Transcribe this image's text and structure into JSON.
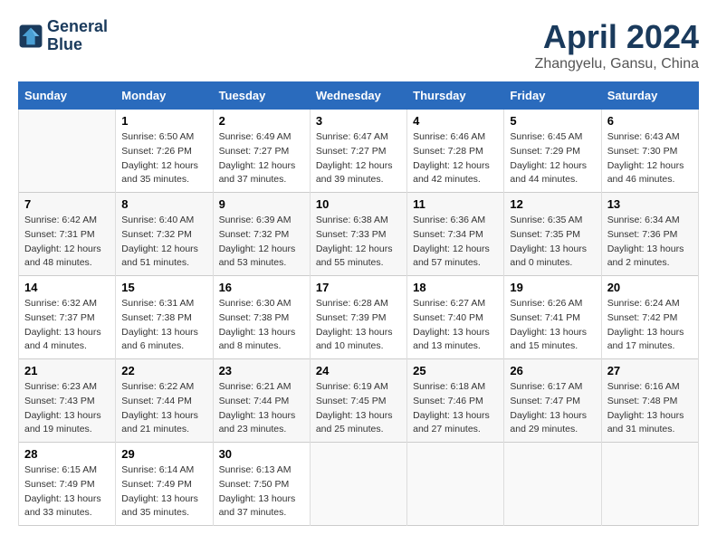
{
  "header": {
    "logo_line1": "General",
    "logo_line2": "Blue",
    "main_title": "April 2024",
    "sub_title": "Zhangyelu, Gansu, China"
  },
  "weekdays": [
    "Sunday",
    "Monday",
    "Tuesday",
    "Wednesday",
    "Thursday",
    "Friday",
    "Saturday"
  ],
  "weeks": [
    [
      {
        "day": "",
        "sunrise": "",
        "sunset": "",
        "daylight": ""
      },
      {
        "day": "1",
        "sunrise": "Sunrise: 6:50 AM",
        "sunset": "Sunset: 7:26 PM",
        "daylight": "Daylight: 12 hours and 35 minutes."
      },
      {
        "day": "2",
        "sunrise": "Sunrise: 6:49 AM",
        "sunset": "Sunset: 7:27 PM",
        "daylight": "Daylight: 12 hours and 37 minutes."
      },
      {
        "day": "3",
        "sunrise": "Sunrise: 6:47 AM",
        "sunset": "Sunset: 7:27 PM",
        "daylight": "Daylight: 12 hours and 39 minutes."
      },
      {
        "day": "4",
        "sunrise": "Sunrise: 6:46 AM",
        "sunset": "Sunset: 7:28 PM",
        "daylight": "Daylight: 12 hours and 42 minutes."
      },
      {
        "day": "5",
        "sunrise": "Sunrise: 6:45 AM",
        "sunset": "Sunset: 7:29 PM",
        "daylight": "Daylight: 12 hours and 44 minutes."
      },
      {
        "day": "6",
        "sunrise": "Sunrise: 6:43 AM",
        "sunset": "Sunset: 7:30 PM",
        "daylight": "Daylight: 12 hours and 46 minutes."
      }
    ],
    [
      {
        "day": "7",
        "sunrise": "Sunrise: 6:42 AM",
        "sunset": "Sunset: 7:31 PM",
        "daylight": "Daylight: 12 hours and 48 minutes."
      },
      {
        "day": "8",
        "sunrise": "Sunrise: 6:40 AM",
        "sunset": "Sunset: 7:32 PM",
        "daylight": "Daylight: 12 hours and 51 minutes."
      },
      {
        "day": "9",
        "sunrise": "Sunrise: 6:39 AM",
        "sunset": "Sunset: 7:32 PM",
        "daylight": "Daylight: 12 hours and 53 minutes."
      },
      {
        "day": "10",
        "sunrise": "Sunrise: 6:38 AM",
        "sunset": "Sunset: 7:33 PM",
        "daylight": "Daylight: 12 hours and 55 minutes."
      },
      {
        "day": "11",
        "sunrise": "Sunrise: 6:36 AM",
        "sunset": "Sunset: 7:34 PM",
        "daylight": "Daylight: 12 hours and 57 minutes."
      },
      {
        "day": "12",
        "sunrise": "Sunrise: 6:35 AM",
        "sunset": "Sunset: 7:35 PM",
        "daylight": "Daylight: 13 hours and 0 minutes."
      },
      {
        "day": "13",
        "sunrise": "Sunrise: 6:34 AM",
        "sunset": "Sunset: 7:36 PM",
        "daylight": "Daylight: 13 hours and 2 minutes."
      }
    ],
    [
      {
        "day": "14",
        "sunrise": "Sunrise: 6:32 AM",
        "sunset": "Sunset: 7:37 PM",
        "daylight": "Daylight: 13 hours and 4 minutes."
      },
      {
        "day": "15",
        "sunrise": "Sunrise: 6:31 AM",
        "sunset": "Sunset: 7:38 PM",
        "daylight": "Daylight: 13 hours and 6 minutes."
      },
      {
        "day": "16",
        "sunrise": "Sunrise: 6:30 AM",
        "sunset": "Sunset: 7:38 PM",
        "daylight": "Daylight: 13 hours and 8 minutes."
      },
      {
        "day": "17",
        "sunrise": "Sunrise: 6:28 AM",
        "sunset": "Sunset: 7:39 PM",
        "daylight": "Daylight: 13 hours and 10 minutes."
      },
      {
        "day": "18",
        "sunrise": "Sunrise: 6:27 AM",
        "sunset": "Sunset: 7:40 PM",
        "daylight": "Daylight: 13 hours and 13 minutes."
      },
      {
        "day": "19",
        "sunrise": "Sunrise: 6:26 AM",
        "sunset": "Sunset: 7:41 PM",
        "daylight": "Daylight: 13 hours and 15 minutes."
      },
      {
        "day": "20",
        "sunrise": "Sunrise: 6:24 AM",
        "sunset": "Sunset: 7:42 PM",
        "daylight": "Daylight: 13 hours and 17 minutes."
      }
    ],
    [
      {
        "day": "21",
        "sunrise": "Sunrise: 6:23 AM",
        "sunset": "Sunset: 7:43 PM",
        "daylight": "Daylight: 13 hours and 19 minutes."
      },
      {
        "day": "22",
        "sunrise": "Sunrise: 6:22 AM",
        "sunset": "Sunset: 7:44 PM",
        "daylight": "Daylight: 13 hours and 21 minutes."
      },
      {
        "day": "23",
        "sunrise": "Sunrise: 6:21 AM",
        "sunset": "Sunset: 7:44 PM",
        "daylight": "Daylight: 13 hours and 23 minutes."
      },
      {
        "day": "24",
        "sunrise": "Sunrise: 6:19 AM",
        "sunset": "Sunset: 7:45 PM",
        "daylight": "Daylight: 13 hours and 25 minutes."
      },
      {
        "day": "25",
        "sunrise": "Sunrise: 6:18 AM",
        "sunset": "Sunset: 7:46 PM",
        "daylight": "Daylight: 13 hours and 27 minutes."
      },
      {
        "day": "26",
        "sunrise": "Sunrise: 6:17 AM",
        "sunset": "Sunset: 7:47 PM",
        "daylight": "Daylight: 13 hours and 29 minutes."
      },
      {
        "day": "27",
        "sunrise": "Sunrise: 6:16 AM",
        "sunset": "Sunset: 7:48 PM",
        "daylight": "Daylight: 13 hours and 31 minutes."
      }
    ],
    [
      {
        "day": "28",
        "sunrise": "Sunrise: 6:15 AM",
        "sunset": "Sunset: 7:49 PM",
        "daylight": "Daylight: 13 hours and 33 minutes."
      },
      {
        "day": "29",
        "sunrise": "Sunrise: 6:14 AM",
        "sunset": "Sunset: 7:49 PM",
        "daylight": "Daylight: 13 hours and 35 minutes."
      },
      {
        "day": "30",
        "sunrise": "Sunrise: 6:13 AM",
        "sunset": "Sunset: 7:50 PM",
        "daylight": "Daylight: 13 hours and 37 minutes."
      },
      {
        "day": "",
        "sunrise": "",
        "sunset": "",
        "daylight": ""
      },
      {
        "day": "",
        "sunrise": "",
        "sunset": "",
        "daylight": ""
      },
      {
        "day": "",
        "sunrise": "",
        "sunset": "",
        "daylight": ""
      },
      {
        "day": "",
        "sunrise": "",
        "sunset": "",
        "daylight": ""
      }
    ]
  ]
}
